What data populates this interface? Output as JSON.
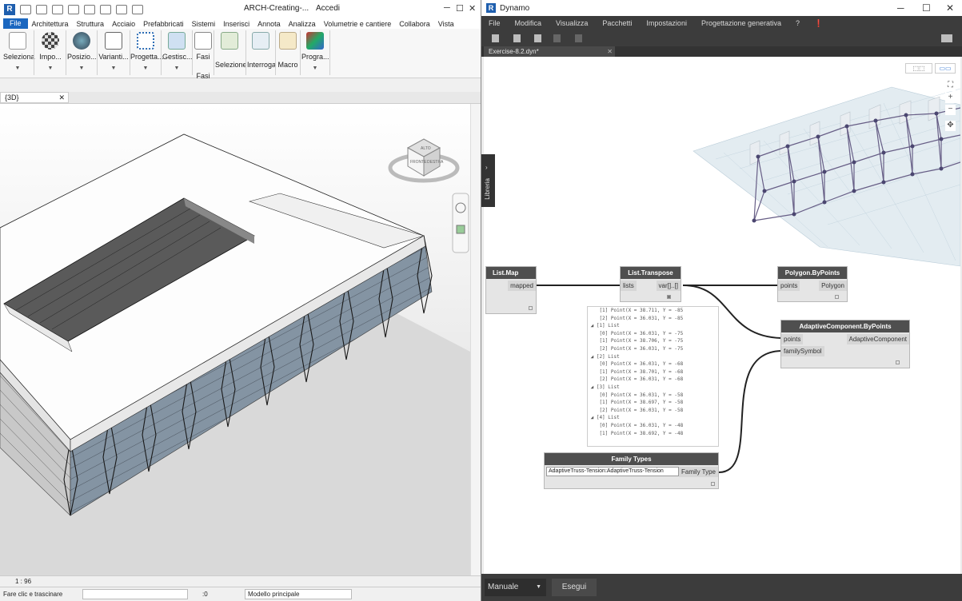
{
  "revit": {
    "title": "ARCH-Creating-...",
    "sign_in": "Accedi",
    "menu": [
      "File",
      "Architettura",
      "Struttura",
      "Acciaio",
      "Prefabbricati",
      "Sistemi",
      "Inserisci",
      "Annota",
      "Analizza",
      "Volumetrie e cantiere",
      "Collabora",
      "Vista"
    ],
    "ribbon": [
      "Seleziona",
      "Impo...",
      "Posizio...",
      "Varianti...",
      "Progetta...",
      "Gestisc...",
      "Fasi",
      "Selezione",
      "Interroga",
      "Macro",
      "Progra..."
    ],
    "ribbon_group_fasi": "Fasi",
    "view_tab": "{3D}",
    "viewcube": [
      "ALTO",
      "FRONTE",
      "DESTRA"
    ],
    "scale": "1 : 96",
    "status_hint": "Fare clic e trascinare",
    "zero": ":0",
    "model": "Modello principale"
  },
  "dynamo": {
    "title": "Dynamo",
    "menu": [
      "File",
      "Modifica",
      "Visualizza",
      "Pacchetti",
      "Impostazioni",
      "Progettazione generativa",
      "?"
    ],
    "tab": "Exercise-8.2.dyn*",
    "library": "Libreria",
    "run_mode": "Manuale",
    "run_button": "Esegui",
    "nodes": {
      "list_map": {
        "title": "List.Map",
        "output": "mapped"
      },
      "list_transpose": {
        "title": "List.Transpose",
        "input": "lists",
        "output": "var[]..[]"
      },
      "polygon": {
        "title": "Polygon.ByPoints",
        "input": "points",
        "output": "Polygon"
      },
      "adaptive": {
        "title": "AdaptiveComponent.ByPoints",
        "inputs": [
          "points",
          "familySymbol"
        ],
        "output": "AdaptiveComponent"
      },
      "family_types": {
        "title": "Family Types",
        "selected": "AdaptiveTruss-Tension:AdaptiveTruss-Tension",
        "output": "Family Type"
      }
    },
    "watch_lines": [
      "    [1] Point(X = 38.711, Y = -85",
      "    [2] Point(X = 36.031, Y = -85",
      " ◢ [1] List",
      "    [0] Point(X = 36.031, Y = -75",
      "    [1] Point(X = 38.706, Y = -75",
      "    [2] Point(X = 36.031, Y = -75",
      " ◢ [2] List",
      "    [0] Point(X = 36.031, Y = -68",
      "    [1] Point(X = 38.701, Y = -68",
      "    [2] Point(X = 36.031, Y = -68",
      " ◢ [3] List",
      "    [0] Point(X = 36.031, Y = -58",
      "    [1] Point(X = 38.697, Y = -58",
      "    [2] Point(X = 36.031, Y = -58",
      " ◢ [4] List",
      "    [0] Point(X = 36.031, Y = -48",
      "    [1] Point(X = 38.692, Y = -48"
    ]
  }
}
